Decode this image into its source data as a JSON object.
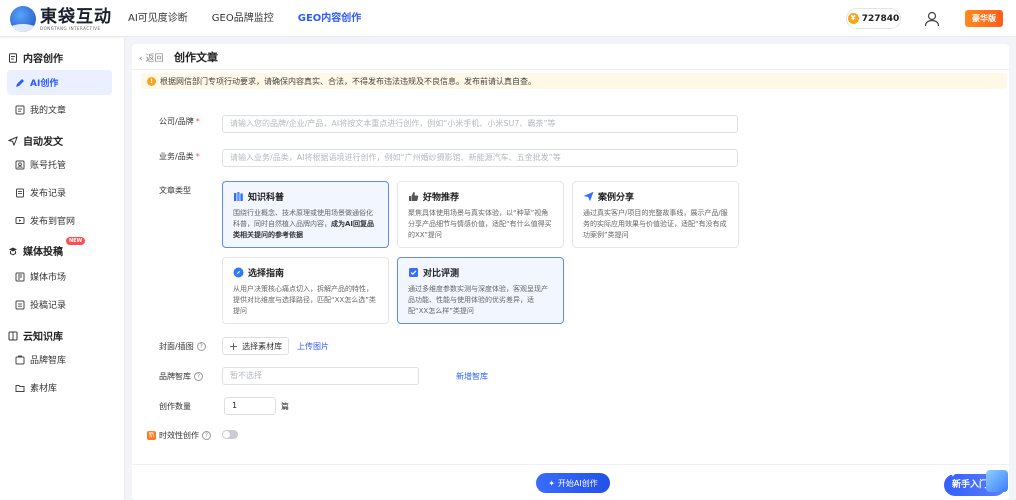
{
  "app": {
    "logo_cn": "東袋互动",
    "logo_en": "DONGTANG INTERACTIVE"
  },
  "nav": [
    {
      "label": "AI可见度诊断",
      "active": false
    },
    {
      "label": "GEO品牌监控",
      "active": false
    },
    {
      "label": "GEO内容创作",
      "active": true
    }
  ],
  "topbar": {
    "coins": "727840",
    "vip_label": "豪华版"
  },
  "sidebar": {
    "groups": [
      {
        "label": "内容创作",
        "items": [
          {
            "label": "AI创作",
            "active": true
          },
          {
            "label": "我的文章",
            "active": false
          }
        ]
      },
      {
        "label": "自动发文",
        "items": [
          {
            "label": "账号托管"
          },
          {
            "label": "发布记录"
          },
          {
            "label": "发布到官网"
          }
        ]
      },
      {
        "label": "媒体投稿",
        "badge": "NEW",
        "items": [
          {
            "label": "媒体市场"
          },
          {
            "label": "投稿记录"
          }
        ]
      },
      {
        "label": "云知识库",
        "items": [
          {
            "label": "品牌智库"
          },
          {
            "label": "素材库"
          }
        ]
      }
    ]
  },
  "header": {
    "back_label": "返回",
    "title": "创作文章"
  },
  "notice": "根据网信部门专项行动要求，请确保内容真实、合法，不得发布违法违规及不良信息。发布前请认真自查。",
  "form": {
    "company_label": "公司/品牌",
    "company_placeholder": "请输入您的品牌/企业/产品，AI将按文本重点进行创作，例如“小米手机、小米SU7、霸茶”等",
    "business_label": "业务/品类",
    "business_placeholder": "请输入业务/品类，AI将根据语境进行创作，例如“广州婚纱摄影馆、新能源汽车、五金批发”等",
    "type_label": "文章类型",
    "cover_label": "封面/插图",
    "select_library_label": "选择素材库",
    "upload_label": "上传图片",
    "brand_library_label": "品牌智库",
    "brand_library_placeholder": "暂不选择",
    "new_library_label": "新增智库",
    "count_label": "创作数量",
    "count_value": "1",
    "count_unit": "篇",
    "timely_label": "时效性创作",
    "timely_icon_text": "新",
    "start_label": "开始AI创作"
  },
  "article_types": [
    {
      "title": "知识科普",
      "desc": "围绕行业概念、技术原理或使用场景做通俗化科普，同时自然植入品牌内容，",
      "desc_bold": "成为AI回复品类相关提问的参考依据",
      "selected": true,
      "icon_color": "#3a6bff"
    },
    {
      "title": "好物推荐",
      "desc": "聚焦具体使用场景与真实体验，以“种草”视角分享产品细节与情感价值，适配“有什么值得买的XX”提问",
      "selected": false,
      "icon_color": "#555555"
    },
    {
      "title": "案例分享",
      "desc": "通过真实客户/项目的完整故事线，展示产品/服务的实际应用效果与价值验证，适配“有没有成功案例”类提问",
      "selected": false,
      "icon_color": "#3a6bff"
    },
    {
      "title": "选择指南",
      "desc": "从用户决策核心痛点切入，拆解产品的特性，提供对比维度与选择路径，匹配“XX怎么选”类提问",
      "selected": false,
      "icon_color": "#2c7bff"
    },
    {
      "title": "对比评测",
      "desc": "通过多维度参数实测与深度体验，客观呈现产品功能、性能与使用体验的优劣差异，适配“XX怎么样”类提问",
      "selected": true,
      "icon_color": "#3a6bff"
    }
  ],
  "guide_label": "新手入门",
  "colors": {
    "accent": "#2c5bff",
    "warning": "#f5a623",
    "danger": "#ff4d4f"
  }
}
